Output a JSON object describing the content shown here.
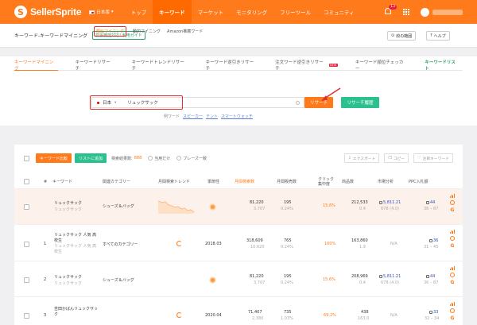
{
  "nav": {
    "logo_text": "SellerSprite",
    "lang": "日本版",
    "menu": [
      "トップ",
      "キーワード",
      "マーケット",
      "モニタリング",
      "フリーツール",
      "コミュニティ"
    ],
    "active_menu": "キーワード",
    "notification_count": "13"
  },
  "titlebar": {
    "title": "キーワード-キーワードマイニング",
    "tag": "拡張機能対応! 利用ガイド",
    "range_btn": "絞の範囲",
    "help_btn": "ヘルプ"
  },
  "tabs": [
    {
      "label": "キーワードマイニング",
      "active": true
    },
    {
      "label": "キーワードリサーチ"
    },
    {
      "label": "キーワードトレンドリサーチ"
    },
    {
      "label": "キーワード逆引きリサーチ"
    },
    {
      "label": "注文ワード逆引きリサーチ",
      "badge": "NEW"
    },
    {
      "label": "キーワード順位チェッカー"
    },
    {
      "label": "キーワードリスト",
      "green": true
    }
  ],
  "modes": [
    "類似マイニング",
    "動的マイニング",
    "Amazon推薦ワード"
  ],
  "search": {
    "marketplace": "日本",
    "keyword": "リュックサック",
    "search_btn": "リサーチ",
    "history_btn": "リサーチ履歴"
  },
  "examples": {
    "label": "例ワード",
    "items": [
      "スピーカー",
      "テント",
      "スマートウォッチ"
    ]
  },
  "toolbar": {
    "compare_btn": "キーワード比較",
    "add_list_btn": "リストに追加",
    "result_label": "検索結果数:",
    "result_count": "888",
    "filter1": "当用だけ",
    "filter2": "ブレーズ一致",
    "export_btn": "エクスポート",
    "copy_btn": "コピー",
    "fav_btn": "注目キーワード"
  },
  "columns": [
    "#",
    "キーワード",
    "関連カテゴリー",
    "月間検索トレンド",
    "季節性",
    "月間検索数",
    "月間販売数",
    "クリック集中度",
    "商品数",
    "市場分析",
    "PPC入札額"
  ],
  "rows": [
    {
      "num": "",
      "kw": "リュックサック",
      "kw_sub": "リュックサック",
      "category": "シューズ＆バッグ",
      "season": "sun",
      "search": "81,220",
      "search_sub": "3,707",
      "sales": "195",
      "sales_sub": "0.24%",
      "click": "15.6%",
      "products": "212,533",
      "products_sub": "0.4",
      "market": "5,811.21",
      "market_sub": "678 (4.0)",
      "ppc": "44",
      "ppc_sub": "36 – 87",
      "highlight": true
    },
    {
      "num": "1",
      "kw": "リュックサック 人気 高校生",
      "kw_sub": "リュックサック 人気 高校生",
      "category": "すべてのカテゴリー",
      "season": "sync",
      "season_text": "2018.03",
      "search": "318,609",
      "search_sub": "10,620",
      "sales": "765",
      "sales_sub": "0.24%",
      "click": "100%",
      "products": "163,860",
      "products_sub": "1.9",
      "market": "N/A",
      "market_sub": "",
      "ppc": "36",
      "ppc_sub": "31 – 45"
    },
    {
      "num": "2",
      "kw": "リュックサック",
      "kw_sub": "リュックサック",
      "category": "シューズ＆バッグ",
      "season": "sun",
      "search": "81,220",
      "search_sub": "3,707",
      "sales": "195",
      "sales_sub": "0.24%",
      "click": "15.6%",
      "products": "208,969",
      "products_sub": "0.4",
      "market": "5,811.21",
      "market_sub": "678 (4.0)",
      "ppc": "44",
      "ppc_sub": "36 – 87"
    },
    {
      "num": "3",
      "kw": "吉田かばんリュックサック",
      "kw_sub": "",
      "category": "",
      "season": "sync",
      "season_text": "2020.04",
      "search": "71,407",
      "search_sub": "2,380",
      "sales": "735",
      "sales_sub": "1.03%",
      "click": "69.2%",
      "products": "438",
      "products_sub": "163.0",
      "market": "N/A",
      "market_sub": "",
      "ppc": "33",
      "ppc_sub": "32 – 34"
    }
  ],
  "colors": {
    "brand": "#ff7a1a",
    "green": "#2cc08e",
    "highlight": "#e03030"
  }
}
